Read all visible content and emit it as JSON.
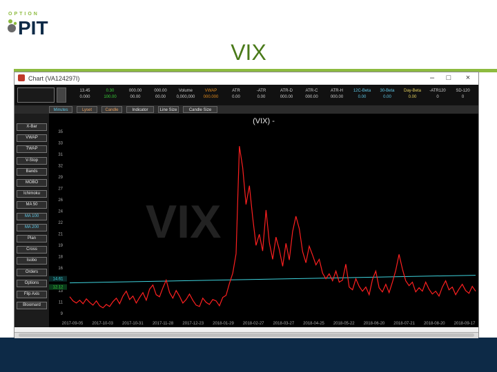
{
  "slide": {
    "logo_top": "OPTION",
    "logo_main": "PIT",
    "title": "VIX",
    "colors": {
      "title": "#4a7a1a",
      "rule": "#8dbb3f",
      "footer": "#0d2a47"
    }
  },
  "window": {
    "title": "Chart (VA124297I)",
    "controls": [
      "–",
      "□",
      "×"
    ]
  },
  "stats": [
    {
      "h": "13.45",
      "v": "0.000",
      "hc": "#cfcfcf",
      "vc": "#cfcfcf"
    },
    {
      "h": "0.30",
      "v": "100.00",
      "hc": "#3ad13a",
      "vc": "#3ad13a"
    },
    {
      "h": "000.00",
      "v": "00.00",
      "hc": "#cfcfcf",
      "vc": "#cfcfcf"
    },
    {
      "h": "000.00",
      "v": "00.00",
      "hc": "#cfcfcf",
      "vc": "#cfcfcf"
    },
    {
      "h": "Volume",
      "v": "0,000,000",
      "hc": "#cfcfcf",
      "vc": "#cfcfcf"
    },
    {
      "h": "VWAP",
      "v": "000.000",
      "hc": "#e08a1e",
      "vc": "#e08a1e"
    },
    {
      "h": "ATR",
      "v": "0.00",
      "hc": "#cfcfcf",
      "vc": "#cfcfcf"
    },
    {
      "h": "-ATR",
      "v": "0.00",
      "hc": "#cfcfcf",
      "vc": "#cfcfcf"
    },
    {
      "h": "ATR-D",
      "v": "000.00",
      "hc": "#cfcfcf",
      "vc": "#cfcfcf"
    },
    {
      "h": "ATR-C",
      "v": "000.00",
      "hc": "#cfcfcf",
      "vc": "#cfcfcf"
    },
    {
      "h": "ATR-H",
      "v": "000.00",
      "hc": "#cfcfcf",
      "vc": "#cfcfcf"
    },
    {
      "h": "12C-Beta",
      "v": "0.00",
      "hc": "#5fc9e8",
      "vc": "#5fc9e8"
    },
    {
      "h": "30-Beta",
      "v": "0.00",
      "hc": "#5fc9e8",
      "vc": "#5fc9e8"
    },
    {
      "h": "Day-Beta",
      "v": "0.00",
      "hc": "#e8d35f",
      "vc": "#e8d35f"
    },
    {
      "h": "-ATR120",
      "v": "0",
      "hc": "#cfcfcf",
      "vc": "#cfcfcf"
    },
    {
      "h": "SD-120",
      "v": "0",
      "hc": "#cfcfcf",
      "vc": "#cfcfcf"
    }
  ],
  "tabs": [
    "Minutes",
    "Lyset",
    "Candle",
    "Indicator",
    "Line Size",
    "Candle Size"
  ],
  "side_buttons": [
    "X-Bar",
    "VWAP",
    "TWAP",
    "V-Stop",
    "Bands",
    "MOBO",
    "Ichimoku",
    "MA 50",
    "MA 100",
    "MA 200",
    "Plan",
    "Cross",
    "Isobo",
    "Orders",
    "Options",
    "Flip Axis",
    "Bloomard"
  ],
  "side_active": [
    8,
    9
  ],
  "chart": {
    "title": "(VIX) -",
    "watermark": "VIX",
    "colors": {
      "line": "#ff2020",
      "baseline": "#3fd6e0",
      "watermark": "#3a3a3a"
    }
  },
  "chart_data": {
    "type": "line",
    "title": "(VIX) -",
    "y_ticks": [
      "35",
      "33",
      "31",
      "32",
      "29",
      "27",
      "26",
      "24",
      "22",
      "21",
      "19",
      "18",
      "16",
      "14",
      "13",
      "11",
      "9"
    ],
    "x_ticks": [
      "2017-09-05",
      "2017-10-03",
      "2017-10-31",
      "2017-11-28",
      "2017-12-23",
      "2018-01-29",
      "2018-02-27",
      "2018-03-27",
      "2018-04-25",
      "2018-05-22",
      "2018-06-20",
      "2018-07-21",
      "2018-08-20",
      "2018-09-17"
    ],
    "ylim": [
      9,
      36
    ],
    "current_labels": [
      "14.61",
      "12.12"
    ],
    "series": [
      {
        "values": [
          11.8,
          11.2,
          10.9,
          11.3,
          10.8,
          11.5,
          11.0,
          10.6,
          11.2,
          10.5,
          10.2,
          10.7,
          10.4,
          11.1,
          11.6,
          10.8,
          11.9,
          12.6,
          11.4,
          11.9,
          10.9,
          11.7,
          12.4,
          11.3,
          12.9,
          13.5,
          12.1,
          11.8,
          13.1,
          14.2,
          12.4,
          11.6,
          12.7,
          11.9,
          10.9,
          11.4,
          12.2,
          11.3,
          10.6,
          10.4,
          11.6,
          11.0,
          10.7,
          11.4,
          11.2,
          10.5,
          11.7,
          12.0,
          13.7,
          15.2,
          18.0,
          33.5,
          30.4,
          25.1,
          27.8,
          23.2,
          19.2,
          20.8,
          18.4,
          24.3,
          19.6,
          17.2,
          20.4,
          18.6,
          16.2,
          19.5,
          17.1,
          21.2,
          23.4,
          21.6,
          18.3,
          16.7,
          19.1,
          17.8,
          16.4,
          17.2,
          15.2,
          14.4,
          15.1,
          14.1,
          15.5,
          13.9,
          14.2,
          16.5,
          13.2,
          12.8,
          14.4,
          13.3,
          12.6,
          13.2,
          12.1,
          14.3,
          15.5,
          13.1,
          12.5,
          13.6,
          12.4,
          13.9,
          15.6,
          17.9,
          15.8,
          14.1,
          13.4,
          13.9,
          12.5,
          13.1,
          12.6,
          13.9,
          12.9,
          12.2,
          12.6,
          11.9,
          13.2,
          14.1,
          12.8,
          13.2,
          12.1,
          12.9,
          13.6,
          12.7,
          12.3,
          13.3,
          12.6
        ]
      }
    ]
  }
}
